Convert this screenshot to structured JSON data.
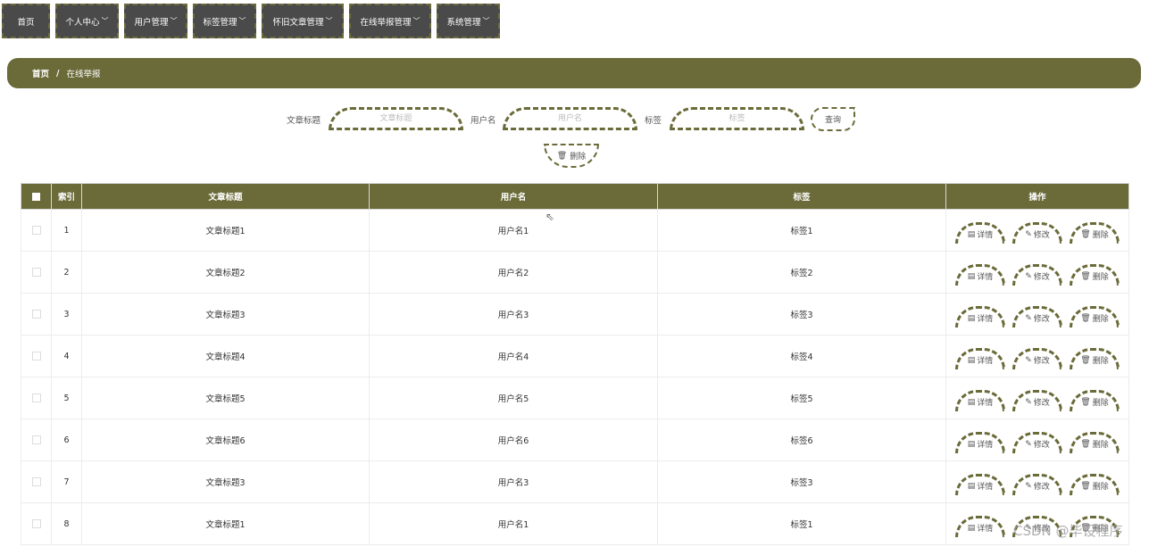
{
  "nav": [
    {
      "label": "首页",
      "chev": false
    },
    {
      "label": "个人中心",
      "chev": true
    },
    {
      "label": "用户管理",
      "chev": true
    },
    {
      "label": "标签管理",
      "chev": true
    },
    {
      "label": "怀旧文章管理",
      "chev": true
    },
    {
      "label": "在线举报管理",
      "chev": true
    },
    {
      "label": "系统管理",
      "chev": true
    }
  ],
  "breadcrumb": {
    "home": "首页",
    "sep": "/",
    "current": "在线举报"
  },
  "search": {
    "title_label": "文章标题",
    "title_placeholder": "文章标题",
    "user_label": "用户名",
    "user_placeholder": "用户名",
    "tag_label": "标签",
    "tag_placeholder": "标签",
    "query_btn": "查询",
    "delete_btn": "删除"
  },
  "table": {
    "headers": {
      "index": "索引",
      "title": "文章标题",
      "user": "用户名",
      "tag": "标签",
      "ops": "操作"
    },
    "rows": [
      {
        "index": "1",
        "title": "文章标题1",
        "user": "用户名1",
        "tag": "标签1"
      },
      {
        "index": "2",
        "title": "文章标题2",
        "user": "用户名2",
        "tag": "标签2"
      },
      {
        "index": "3",
        "title": "文章标题3",
        "user": "用户名3",
        "tag": "标签3"
      },
      {
        "index": "4",
        "title": "文章标题4",
        "user": "用户名4",
        "tag": "标签4"
      },
      {
        "index": "5",
        "title": "文章标题5",
        "user": "用户名5",
        "tag": "标签5"
      },
      {
        "index": "6",
        "title": "文章标题6",
        "user": "用户名6",
        "tag": "标签6"
      },
      {
        "index": "7",
        "title": "文章标题3",
        "user": "用户名3",
        "tag": "标签3"
      },
      {
        "index": "8",
        "title": "文章标题1",
        "user": "用户名1",
        "tag": "标签1"
      }
    ],
    "ops": {
      "detail": "详情",
      "edit": "修改",
      "delete": "删除"
    }
  },
  "watermark": "CSDN @毕设程序",
  "colors": {
    "accent": "#6b6b3a",
    "nav_bg": "#4a4a4a"
  },
  "icons": {
    "detail": "document-icon",
    "edit": "pencil-icon",
    "delete": "trash-icon",
    "dropdown": "chevron-down-icon"
  }
}
